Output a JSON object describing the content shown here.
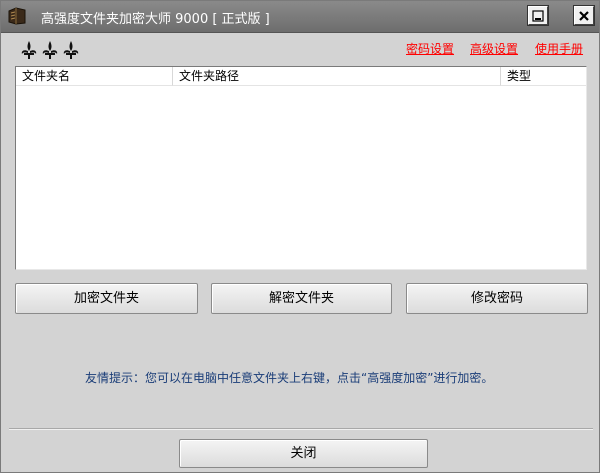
{
  "window": {
    "title": "高强度文件夹加密大师 9000 [ 正式版 ]",
    "icon": "folder-app-icon",
    "controls": {
      "minimize": "minimize-icon",
      "close": "close-icon"
    }
  },
  "toolbar": {
    "logo": "fleur-de-lis-logo",
    "links": {
      "password_settings": "密码设置",
      "advanced_settings": "高级设置",
      "user_manual": "使用手册"
    }
  },
  "list": {
    "columns": [
      "文件夹名",
      "文件夹路径",
      "类型"
    ],
    "rows": []
  },
  "actions": {
    "encrypt": "加密文件夹",
    "decrypt": "解密文件夹",
    "change_password": "修改密码"
  },
  "tip": "友情提示：您可以在电脑中任意文件夹上右键，点击“高强度加密”进行加密。",
  "footer": {
    "close": "关闭"
  },
  "colors": {
    "link": "#ff0000",
    "tip": "#1a3d78",
    "titlebar": "#7a7a7a",
    "background": "#d3d3d3"
  }
}
